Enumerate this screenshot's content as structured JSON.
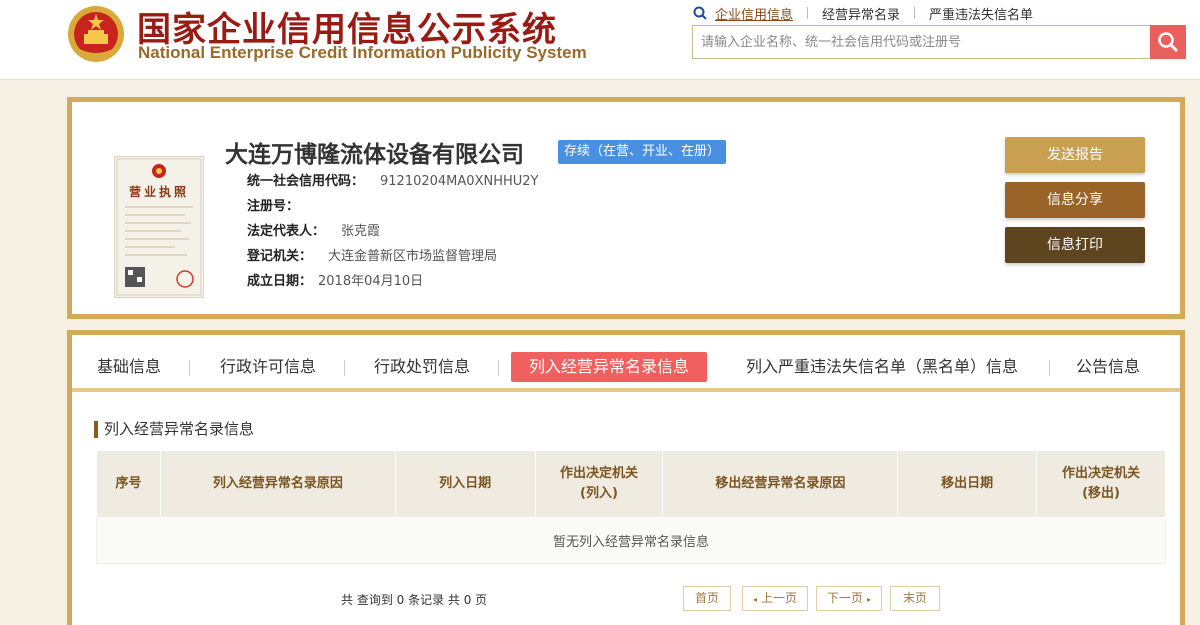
{
  "header": {
    "title_cn": "国家企业信用信息公示系统",
    "title_en": "National Enterprise Credit Information Publicity System",
    "nav": [
      "企业信用信息",
      "经营异常名录",
      "严重违法失信名单"
    ],
    "search_placeholder": "请输入企业名称、统一社会信用代码或注册号"
  },
  "company": {
    "name": "大连万博隆流体设备有限公司",
    "status": "存续（在营、开业、在册）",
    "fields": [
      {
        "label": "统一社会信用代码：",
        "value": "91210204MA0XNHHU2Y"
      },
      {
        "label": "注册号：",
        "value": ""
      },
      {
        "label": "法定代表人：",
        "value": "张克霞"
      },
      {
        "label": "登记机关：",
        "value": "大连金普新区市场监督管理局"
      },
      {
        "label": "成立日期：",
        "value": "2018年04月10日"
      }
    ],
    "license_label": "营业执照"
  },
  "actions": {
    "send_report": "发送报告",
    "share": "信息分享",
    "print": "信息打印"
  },
  "tabs": [
    "基础信息",
    "行政许可信息",
    "行政处罚信息",
    "列入经营异常名录信息",
    "列入严重违法失信名单（黑名单）信息",
    "公告信息"
  ],
  "section": {
    "title": "列入经营异常名录信息",
    "columns": [
      "序号",
      "列入经营异常名录原因",
      "列入日期",
      "作出决定机关\n(列入)",
      "移出经营异常名录原因",
      "移出日期",
      "作出决定机关\n(移出)"
    ],
    "col_a": {
      "c3a": "作出决定机关",
      "c3b": "(列入)",
      "c6a": "作出决定机关",
      "c6b": "(移出)"
    },
    "empty": "暂无列入经营异常名录信息"
  },
  "pager": {
    "info": "共 查询到 0 条记录 共 0 页",
    "first": "首页",
    "prev": "上一页",
    "next": "下一页",
    "last": "末页"
  },
  "colors": {
    "brand_red": "#9a1a14",
    "gold_border": "#d2aa5a",
    "status_blue": "#4a90e2",
    "active_tab": "#f25f5f",
    "btn_send": "#c9a052",
    "btn_share": "#9a6428",
    "btn_print": "#5e4520"
  }
}
